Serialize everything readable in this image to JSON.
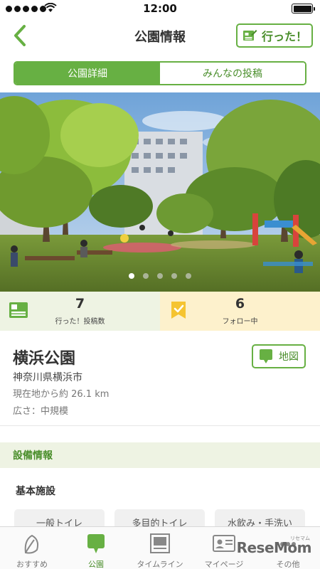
{
  "status_bar": {
    "time": "12:00"
  },
  "nav": {
    "title": "公園情報",
    "went_button": "行った！"
  },
  "segments": {
    "active": "公園詳細",
    "inactive": "みんなの投稿"
  },
  "photo": {
    "dot_count": 5,
    "active_dot": 1
  },
  "stats": {
    "posts": {
      "value": "7",
      "label": "行った！投稿数"
    },
    "follow": {
      "value": "6",
      "label": "フォロー中"
    }
  },
  "park": {
    "name": "横浜公園",
    "address": "神奈川県横浜市",
    "distance": "現在地から約 26.1 km",
    "size": "広さ：中規模",
    "map_button": "地図"
  },
  "facilities": {
    "section_title": "設備情報",
    "subsection": "基本施設",
    "items": [
      "一般トイレ",
      "多目的トイレ",
      "水飲み・手洗い"
    ]
  },
  "tabbar": {
    "items": [
      "おすすめ",
      "公園",
      "タイムライン",
      "マイページ",
      "その他"
    ],
    "active": "公園"
  },
  "watermark": {
    "brand": "ReseMom",
    "sub": "リセマム"
  },
  "colors": {
    "accent": "#67b043",
    "accent_dark": "#4a8e2b",
    "posts_bg": "#eef3e3",
    "follow_bg": "#fdf1cc",
    "follow_icon": "#f5c431"
  }
}
